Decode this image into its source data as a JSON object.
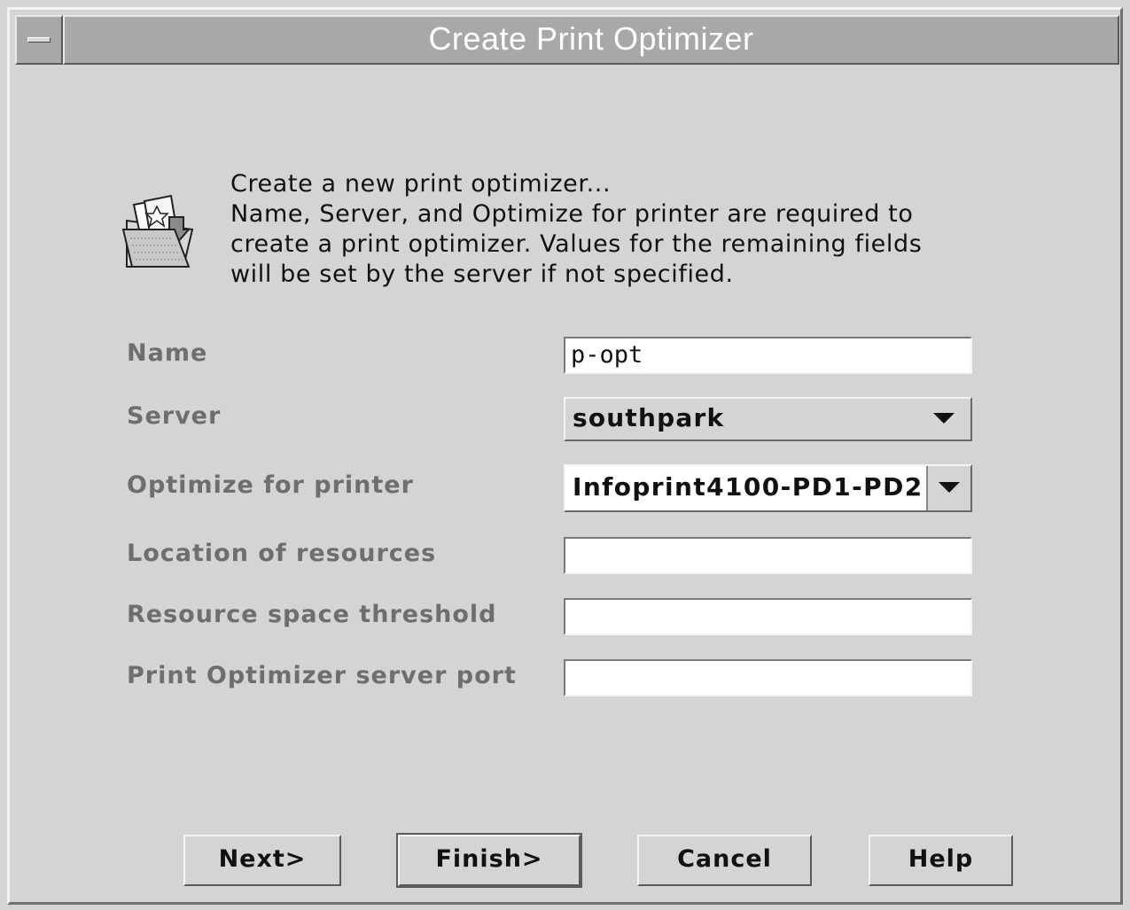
{
  "window": {
    "title": "Create Print Optimizer"
  },
  "intro": {
    "icon": "open-folder-wizard-icon",
    "lines": [
      "Create a new print optimizer...",
      "Name, Server, and Optimize for printer are required to",
      "create a print optimizer. Values for the remaining fields",
      "will be set by the server if not specified."
    ]
  },
  "form": {
    "name": {
      "label": "Name",
      "value": "p-opt"
    },
    "server": {
      "label": "Server",
      "value": "southpark"
    },
    "printer": {
      "label": "Optimize for printer",
      "value": "Infoprint4100-PD1-PD2"
    },
    "location": {
      "label": "Location of resources",
      "value": ""
    },
    "threshold": {
      "label": "Resource space threshold",
      "value": ""
    },
    "port": {
      "label": "Print Optimizer server port",
      "value": ""
    }
  },
  "buttons": {
    "next": "Next>",
    "finish": "Finish>",
    "cancel": "Cancel",
    "help": "Help"
  },
  "colors": {
    "background": "#d4d4d4",
    "titlebar": "#a8a8a8",
    "label_text": "#6e6e6e"
  }
}
